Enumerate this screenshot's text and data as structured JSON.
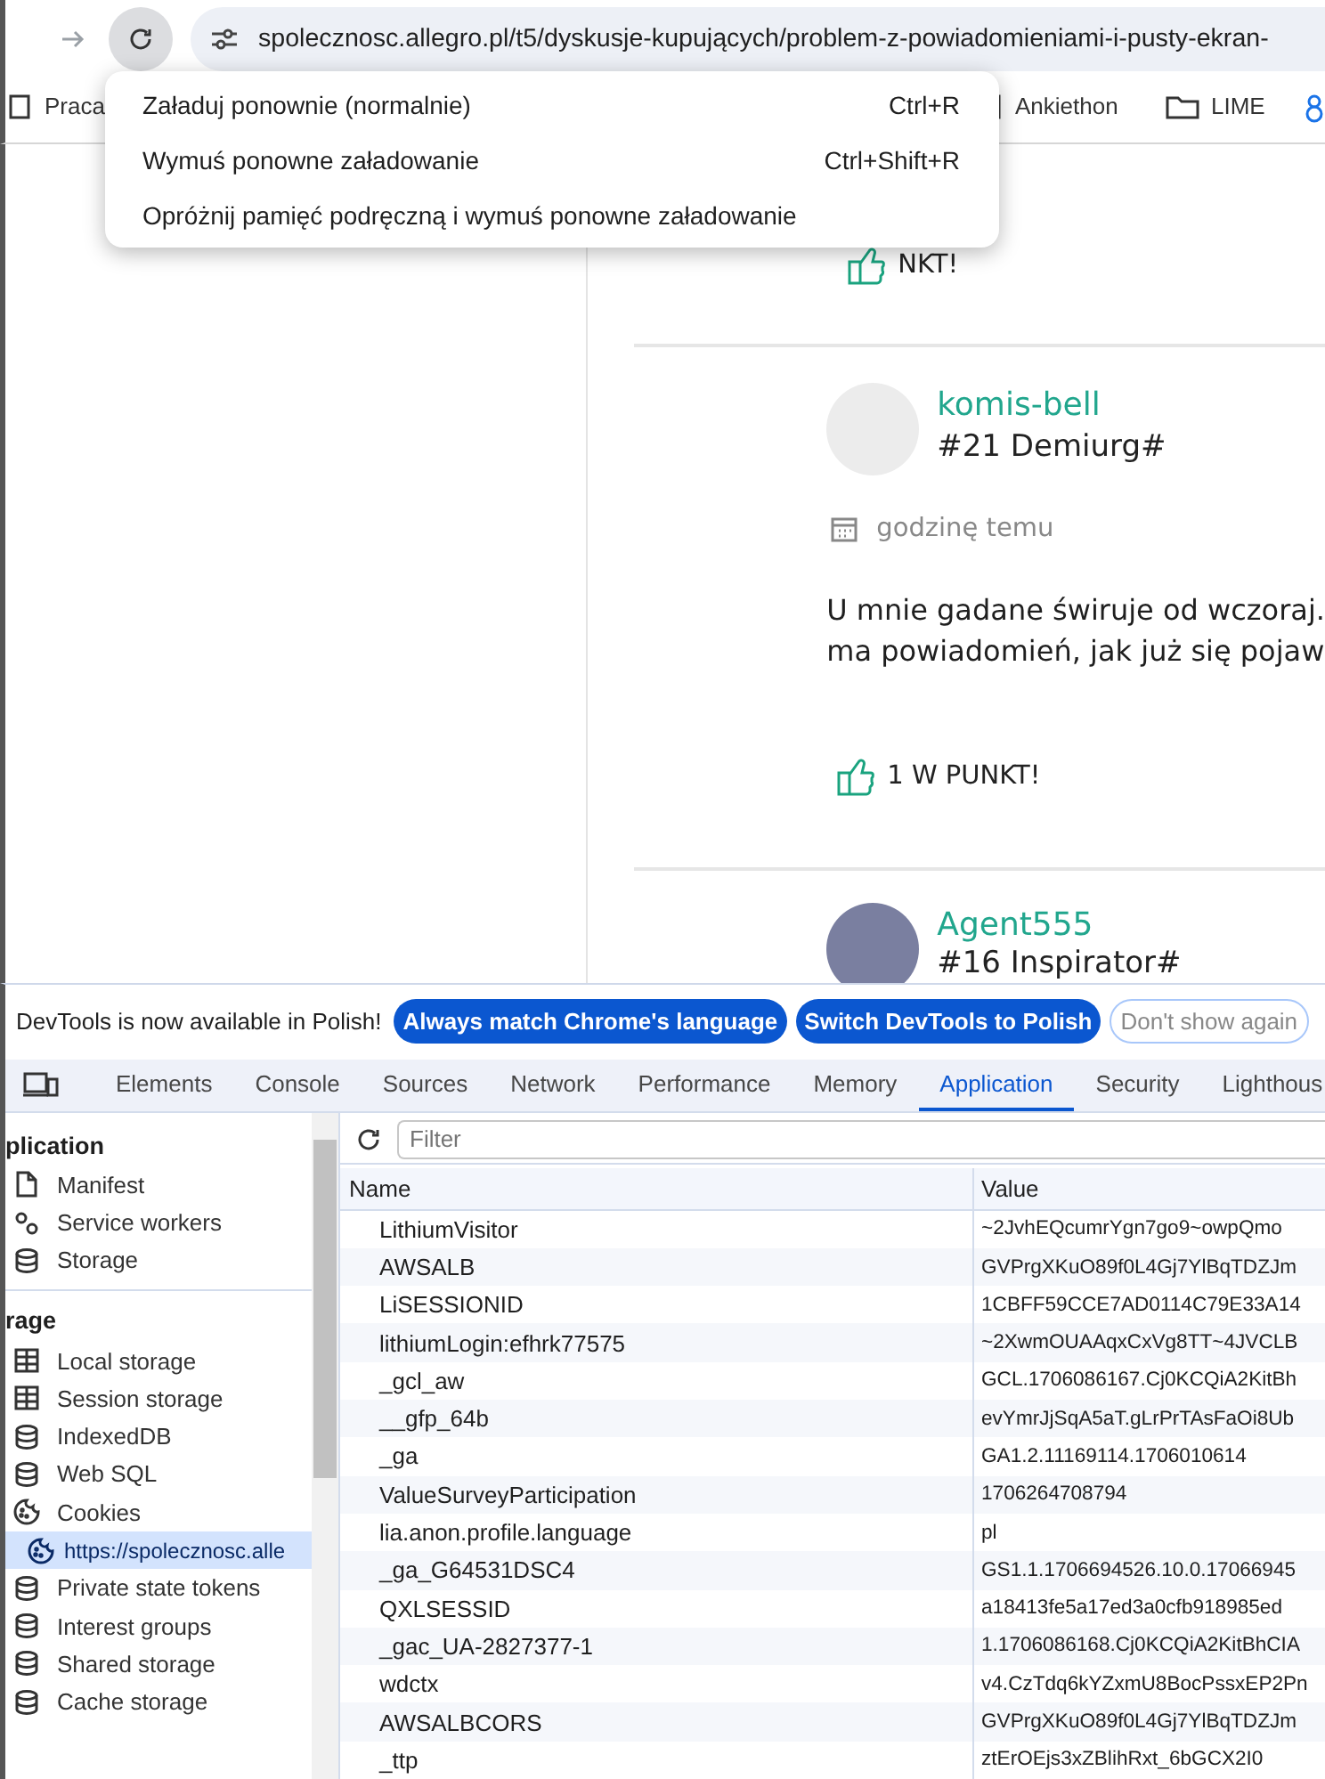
{
  "toolbar": {
    "url": "spolecznosc.allegro.pl/t5/dyskusje-kupujących/problem-z-powiadomieniami-i-pusty-ekran-"
  },
  "bookmarks": [
    {
      "label": "Praca",
      "kind": "page"
    },
    {
      "label": "Ankiethon",
      "kind": "page"
    },
    {
      "label": "LIME",
      "kind": "folder"
    },
    {
      "kind": "ring"
    }
  ],
  "reload_menu": [
    {
      "label": "Załaduj ponownie (normalnie)",
      "shortcut": "Ctrl+R"
    },
    {
      "label": "Wymuś ponowne załadowanie",
      "shortcut": "Ctrl+Shift+R"
    },
    {
      "label": "Opróżnij pamięć podręczną i wymuś ponowne załadowanie"
    }
  ],
  "posts": [
    {
      "kind": "partial",
      "likes": "NKT!"
    },
    {
      "kind": "full",
      "author": "komis-bell",
      "rank": "#21 Demiurg#",
      "time": "godzinę temu",
      "lines": [
        "U mnie gadane świruje od wczoraj.",
        "ma powiadomień, jak już się pojaw"
      ],
      "likes": "1 W PUNKT!"
    },
    {
      "kind": "header",
      "author": "Agent555",
      "rank": "#16 Inspirator#"
    }
  ],
  "devtools": {
    "infobar": {
      "message": "DevTools is now available in Polish!",
      "buttons": [
        {
          "label": "Always match Chrome's language",
          "kind": "primary"
        },
        {
          "label": "Switch DevTools to Polish",
          "kind": "primary"
        },
        {
          "label": "Don't show again",
          "kind": "outline"
        }
      ]
    },
    "tabs": [
      {
        "label": "Elements",
        "selected": false
      },
      {
        "label": "Console",
        "selected": false
      },
      {
        "label": "Sources",
        "selected": false
      },
      {
        "label": "Network",
        "selected": false
      },
      {
        "label": "Performance",
        "selected": false
      },
      {
        "label": "Memory",
        "selected": false
      },
      {
        "label": "Application",
        "selected": true
      },
      {
        "label": "Security",
        "selected": false
      },
      {
        "label": "Lighthous",
        "selected": false
      }
    ],
    "sidebar": [
      {
        "title": "plication",
        "items": [
          {
            "label": "Manifest",
            "kind": "file",
            "selected": false
          },
          {
            "label": "Service workers",
            "kind": "gears",
            "selected": false
          },
          {
            "label": "Storage",
            "kind": "database",
            "selected": false
          }
        ]
      },
      {
        "title": "rage",
        "items": [
          {
            "label": "Local storage",
            "kind": "grid",
            "selected": false
          },
          {
            "label": "Session storage",
            "kind": "grid",
            "selected": false
          },
          {
            "label": "IndexedDB",
            "kind": "database",
            "selected": false
          },
          {
            "label": "Web SQL",
            "kind": "database",
            "selected": false
          },
          {
            "label": "Cookies",
            "kind": "cookie",
            "selected": false,
            "children": [
              {
                "label": "https://spolecznosc.alle",
                "kind": "cookie",
                "selected": true
              }
            ]
          },
          {
            "label": "Private state tokens",
            "kind": "database",
            "selected": false
          },
          {
            "label": "Interest groups",
            "kind": "database",
            "selected": false
          },
          {
            "label": "Shared storage",
            "kind": "database",
            "selected": false
          },
          {
            "label": "Cache storage",
            "kind": "database",
            "selected": false
          }
        ]
      }
    ],
    "filter": {
      "placeholder": "Filter"
    },
    "table": {
      "columns": [
        "Name",
        "Value"
      ],
      "rows": [
        [
          "LithiumVisitor",
          "~2JvhEQcumrYgn7go9~owpQmo"
        ],
        [
          "AWSALB",
          "GVPrgXKuO89f0L4Gj7YlBqTDZJm"
        ],
        [
          "LiSESSIONID",
          "1CBFF59CCE7AD0114C79E33A14"
        ],
        [
          "lithiumLogin:efhrk77575",
          "~2XwmOUAAqxCxVg8TT~4JVCLB"
        ],
        [
          "_gcl_aw",
          "GCL.1706086167.Cj0KCQiA2KitBh"
        ],
        [
          "__gfp_64b",
          "evYmrJjSqA5aT.gLrPrTAsFaOi8Ub"
        ],
        [
          "_ga",
          "GA1.2.11169114.1706010614"
        ],
        [
          "ValueSurveyParticipation",
          "1706264708794"
        ],
        [
          "lia.anon.profile.language",
          "pl"
        ],
        [
          "_ga_G64531DSC4",
          "GS1.1.1706694526.10.0.17066945"
        ],
        [
          "QXLSESSID",
          "a18413fe5a17ed3a0cfb918985ed"
        ],
        [
          "_gac_UA-2827377-1",
          "1.1706086168.Cj0KCQiA2KitBhCIA"
        ],
        [
          "wdctx",
          "v4.CzTdq6kYZxmU8BocPssxEP2Pn"
        ],
        [
          "AWSALBCORS",
          "GVPrgXKuO89f0L4Gj7YlBqTDZJm"
        ],
        [
          "_ttp",
          "ztErOEjs3xZBlihRxt_6bGCX2I0"
        ]
      ]
    }
  }
}
